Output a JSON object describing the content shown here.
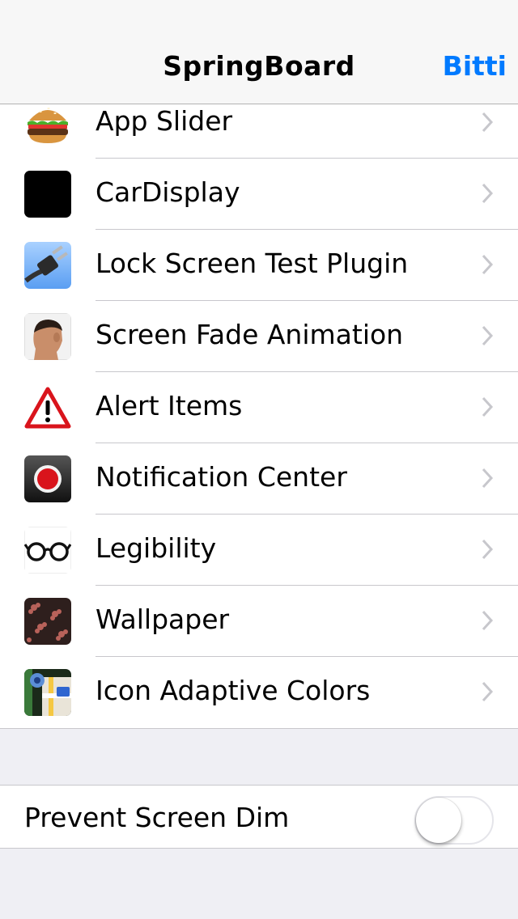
{
  "nav": {
    "title": "SpringBoard",
    "done_label": "Bitti"
  },
  "items": [
    {
      "label": "App Slider",
      "icon": "burger-icon"
    },
    {
      "label": "CarDisplay",
      "icon": "black-square-icon"
    },
    {
      "label": "Lock Screen Test Plugin",
      "icon": "power-plug-icon"
    },
    {
      "label": "Screen Fade Animation",
      "icon": "face-photo-icon"
    },
    {
      "label": "Alert Items",
      "icon": "warning-triangle-icon"
    },
    {
      "label": "Notification Center",
      "icon": "record-button-icon"
    },
    {
      "label": "Legibility",
      "icon": "glasses-icon"
    },
    {
      "label": "Wallpaper",
      "icon": "floral-pattern-icon"
    },
    {
      "label": "Icon Adaptive Colors",
      "icon": "maps-icon"
    }
  ],
  "toggle": {
    "label": "Prevent Screen Dim",
    "on": false
  },
  "colors": {
    "accent": "#007aff",
    "background": "#efeff4",
    "separator": "#c8c7cc"
  }
}
